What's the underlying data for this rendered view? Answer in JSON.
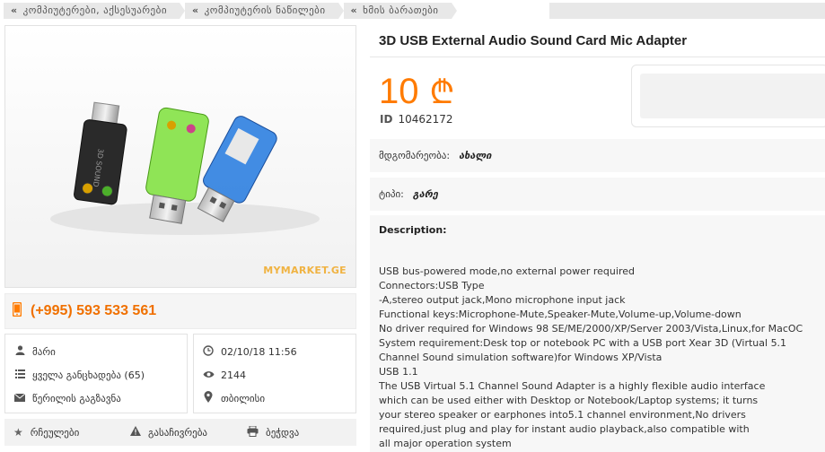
{
  "breadcrumb": [
    {
      "label": "კომპიუტერები, აქსესუარები"
    },
    {
      "label": "კომპიუტერის ნაწილები"
    },
    {
      "label": "ხმის ბარათები"
    }
  ],
  "product": {
    "title": "3D USB External Audio Sound Card Mic Adapter",
    "price": "10",
    "currency_symbol": "₾",
    "id_label": "ID",
    "id_value": "10462172",
    "image_watermark": "MYMARKET.GE"
  },
  "properties": [
    {
      "label": "მდგომარეობა:",
      "value": "ახალი"
    },
    {
      "label": "ტიპი:",
      "value": "გარე"
    }
  ],
  "description": {
    "heading": "Description:",
    "lines": [
      "USB bus-powered mode,no external power required",
      "Connectors:USB Type",
      "-A,stereo output jack,Mono microphone input jack",
      "Functional keys:Microphone-Mute,Speaker-Mute,Volume-up,Volume-down",
      "No driver required for Windows 98 SE/ME/2000/XP/Server 2003/Vista,Linux,for MacOC",
      "System requirement:Desk top or notebook PC with a USB port Xear 3D (Virtual 5.1",
      "Channel Sound simulation software)for Windows XP/Vista",
      "USB 1.1",
      "The USB Virtual 5.1 Channel Sound Adapter is a highly flexible audio interface",
      "which can be used either with Desktop or Notebook/Laptop systems; it turns",
      "your stereo speaker or earphones into5.1 channel environment,No drivers",
      "required,just plug and play for instant audio playback,also compatible with",
      "all major operation system"
    ]
  },
  "seller": {
    "phone": "(+995) 593 533 561",
    "name": "მარი",
    "all_ads": "ყველა განცხადება (65)",
    "send_message": "წერილის გაგზავნა",
    "date": "02/10/18 11:56",
    "views": "2144",
    "location": "თბილისი"
  },
  "actions": {
    "favorites": "რჩეულები",
    "report": "გასაჩივრება",
    "print": "ბეჭდვა"
  },
  "colors": {
    "accent": "#ff7b00",
    "breadcrumb_bg": "#e8e8e8",
    "panel_bg": "#f7f7f7"
  }
}
